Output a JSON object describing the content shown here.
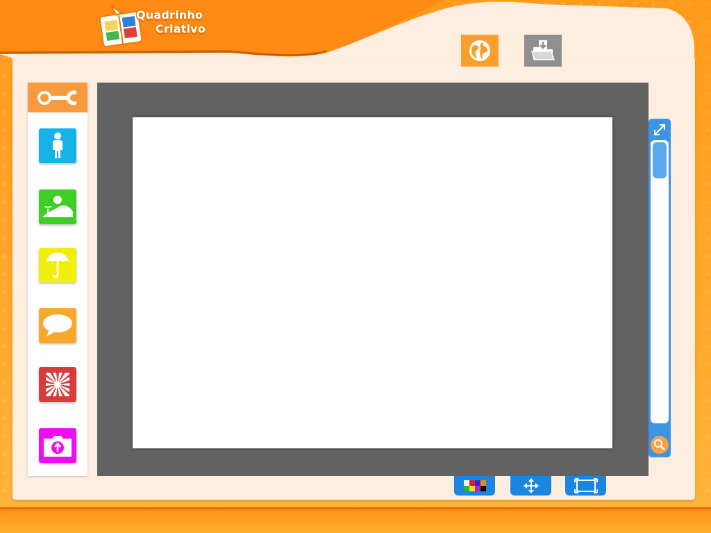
{
  "app": {
    "logo_line1": "Quadrinho",
    "logo_line2": "Criativo"
  },
  "toolbar": {
    "web_button_icon": "globe-icon",
    "open_button_icon": "folder-download-icon"
  },
  "sidebar": {
    "header_icon": "wrench-icon",
    "items": [
      {
        "icon": "person-icon",
        "color": "#15b3e8"
      },
      {
        "icon": "landscape-icon",
        "color": "#3dcf25"
      },
      {
        "icon": "umbrella-icon",
        "color": "#f2ee0c"
      },
      {
        "icon": "speech-bubble-icon",
        "color": "#f8a82a"
      },
      {
        "icon": "burst-icon",
        "color": "#d73b3b"
      },
      {
        "icon": "upload-image-icon",
        "color": "#f00cf0"
      }
    ]
  },
  "zoom": {
    "top_icon": "expand-icon",
    "bottom_icon": "magnifier-icon"
  },
  "bottom_toolbar": {
    "items": [
      {
        "icon": "color-palette-icon"
      },
      {
        "icon": "move-icon"
      },
      {
        "icon": "frame-icon"
      }
    ]
  },
  "colors": {
    "accent_orange": "#f89a3e",
    "workspace_gray": "#626262",
    "blue": "#1a86e0"
  }
}
